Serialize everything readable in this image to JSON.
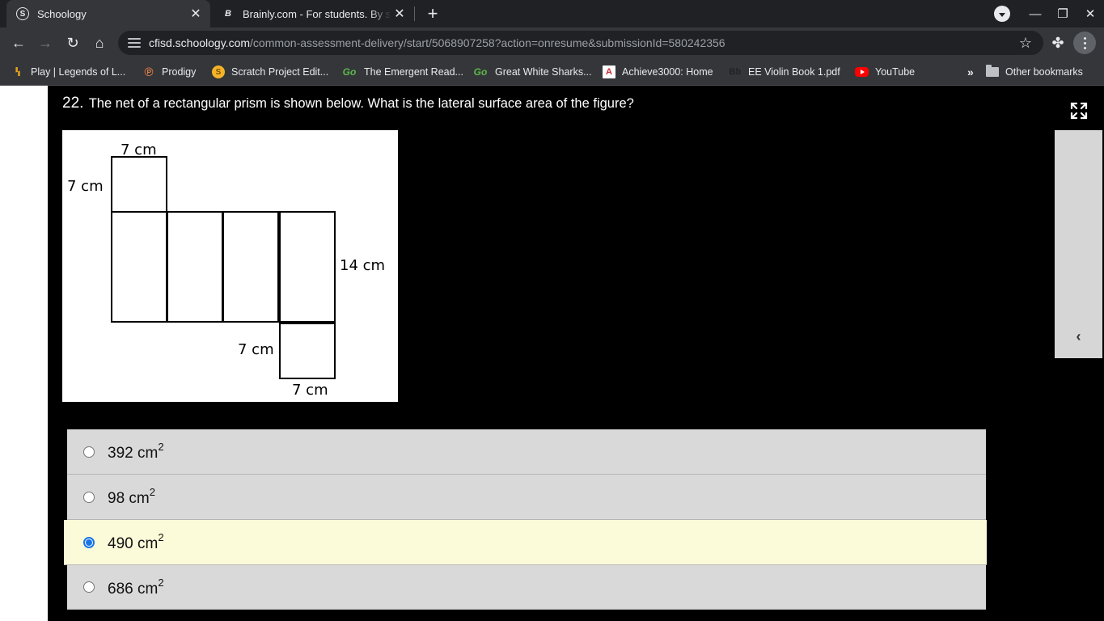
{
  "tabs": [
    {
      "title": "Schoology",
      "icon": "schoology-icon",
      "active": true
    },
    {
      "title": "Brainly.com - For students. By students",
      "icon": "brainly-icon",
      "active": false
    }
  ],
  "omnibox": {
    "host": "cfisd.schoology.com",
    "path": "/common-assessment-delivery/start/5068907258?action=onresume&submissionId=580242356"
  },
  "bookmarks": [
    {
      "label": "Play | Legends of L...",
      "icon": "legends-icon"
    },
    {
      "label": "Prodigy",
      "icon": "prodigy-icon"
    },
    {
      "label": "Scratch Project Edit...",
      "icon": "scratch-icon"
    },
    {
      "label": "The Emergent Read...",
      "icon": "go-icon"
    },
    {
      "label": "Great White Sharks...",
      "icon": "go-icon"
    },
    {
      "label": "Achieve3000: Home",
      "icon": "achieve-icon"
    },
    {
      "label": "EE Violin Book 1.pdf",
      "icon": "blackboard-icon"
    },
    {
      "label": "YouTube",
      "icon": "youtube-icon"
    }
  ],
  "bookmarks_overflow": "»",
  "other_bookmarks": "Other bookmarks",
  "question": {
    "number": "22.",
    "text": "The net of a rectangular prism is shown below.  What is the lateral surface area of the figure?"
  },
  "figure_labels": {
    "top_width": "7 cm",
    "top_height": "7 cm",
    "side_height": "14 cm",
    "bottom_height": "7 cm",
    "bottom_width": "7 cm"
  },
  "choices": [
    {
      "value": "392 cm",
      "exp": "2",
      "selected": false
    },
    {
      "value": "98 cm",
      "exp": "2",
      "selected": false
    },
    {
      "value": "490 cm",
      "exp": "2",
      "selected": true
    },
    {
      "value": "686 cm",
      "exp": "2",
      "selected": false
    }
  ],
  "colors": {
    "selected_choice_bg": "#fbfbd9",
    "choice_bg": "#d9d9d9",
    "radio_accent": "#1a73e8"
  }
}
